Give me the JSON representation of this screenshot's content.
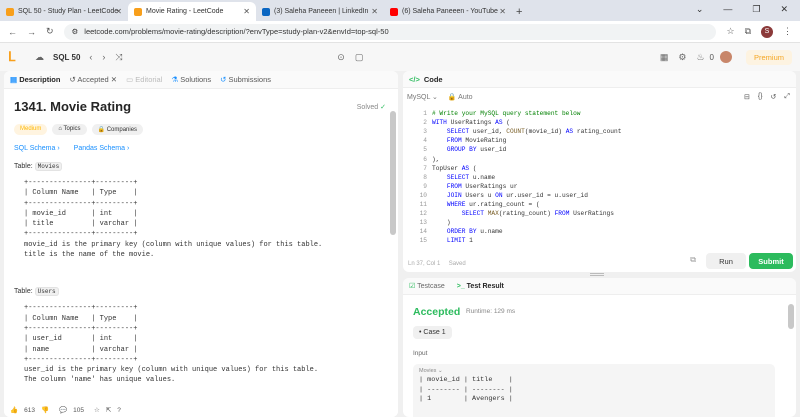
{
  "browser": {
    "tabs": [
      {
        "title": "SQL 50 - Study Plan - LeetCode",
        "color": "#f89f1b"
      },
      {
        "title": "Movie Rating - LeetCode",
        "color": "#f89f1b"
      },
      {
        "title": "(3) Saleha Paneeen | LinkedIn",
        "color": "#0a66c2"
      },
      {
        "title": "(6) Saleha Paneeen - YouTube",
        "color": "#ff0000"
      }
    ],
    "url": "leetcode.com/problems/movie-rating/description/?envType=study-plan-v2&envId=top-sql-50",
    "profile_letter": "S"
  },
  "nav": {
    "study_plan": "SQL 50",
    "coins": "0",
    "premium": "Premium"
  },
  "desc_tabs": [
    "Description",
    "Accepted",
    "Editorial",
    "Solutions",
    "Submissions"
  ],
  "problem": {
    "title": "1341. Movie Rating",
    "status": "Solved",
    "difficulty": "Medium",
    "topics": "Topics",
    "companies": "Companies",
    "schema_links": [
      "SQL Schema",
      "Pandas Schema"
    ],
    "table1_label": "Table:",
    "table1_name": "Movies",
    "table1_ascii": "+---------------+---------+\n| Column Name   | Type    |\n+---------------+---------+\n| movie_id      | int     |\n| title         | varchar |\n+---------------+---------+",
    "table1_desc": "movie_id is the primary key (column with unique values) for this table.\ntitle is the name of the movie.",
    "table2_label": "Table:",
    "table2_name": "Users",
    "table2_ascii": "+---------------+---------+\n| Column Name   | Type    |\n+---------------+---------+\n| user_id       | int     |\n| name          | varchar |\n+---------------+---------+",
    "table2_desc": "user_id is the primary key (column with unique values) for this table.\nThe column 'name' has unique values."
  },
  "footer": {
    "likes": "613",
    "comments": "105"
  },
  "editor": {
    "header": "Code",
    "language": "MySQL",
    "mode": "Auto",
    "status": "Ln 37, Col 1",
    "saved": "Saved",
    "run": "Run",
    "submit": "Submit",
    "lines": [
      "# Write your MySQL query statement below",
      "WITH UserRatings AS (",
      "    SELECT user_id, COUNT(movie_id) AS rating_count",
      "    FROM MovieRating",
      "    GROUP BY user_id",
      "),",
      "TopUser AS (",
      "    SELECT u.name",
      "    FROM UserRatings ur",
      "    JOIN Users u ON ur.user_id = u.user_id",
      "    WHERE ur.rating_count = (",
      "        SELECT MAX(rating_count) FROM UserRatings",
      "    )",
      "    ORDER BY u.name",
      "    LIMIT 1"
    ]
  },
  "result": {
    "tabs": [
      "Testcase",
      "Test Result"
    ],
    "verdict": "Accepted",
    "runtime": "Runtime: 129 ms",
    "case": "Case 1",
    "input_label": "Input",
    "table_label": "Movies",
    "input_ascii": "| movie_id | title    |\n| -------- | -------- |\n| 1        | Avengers |"
  }
}
